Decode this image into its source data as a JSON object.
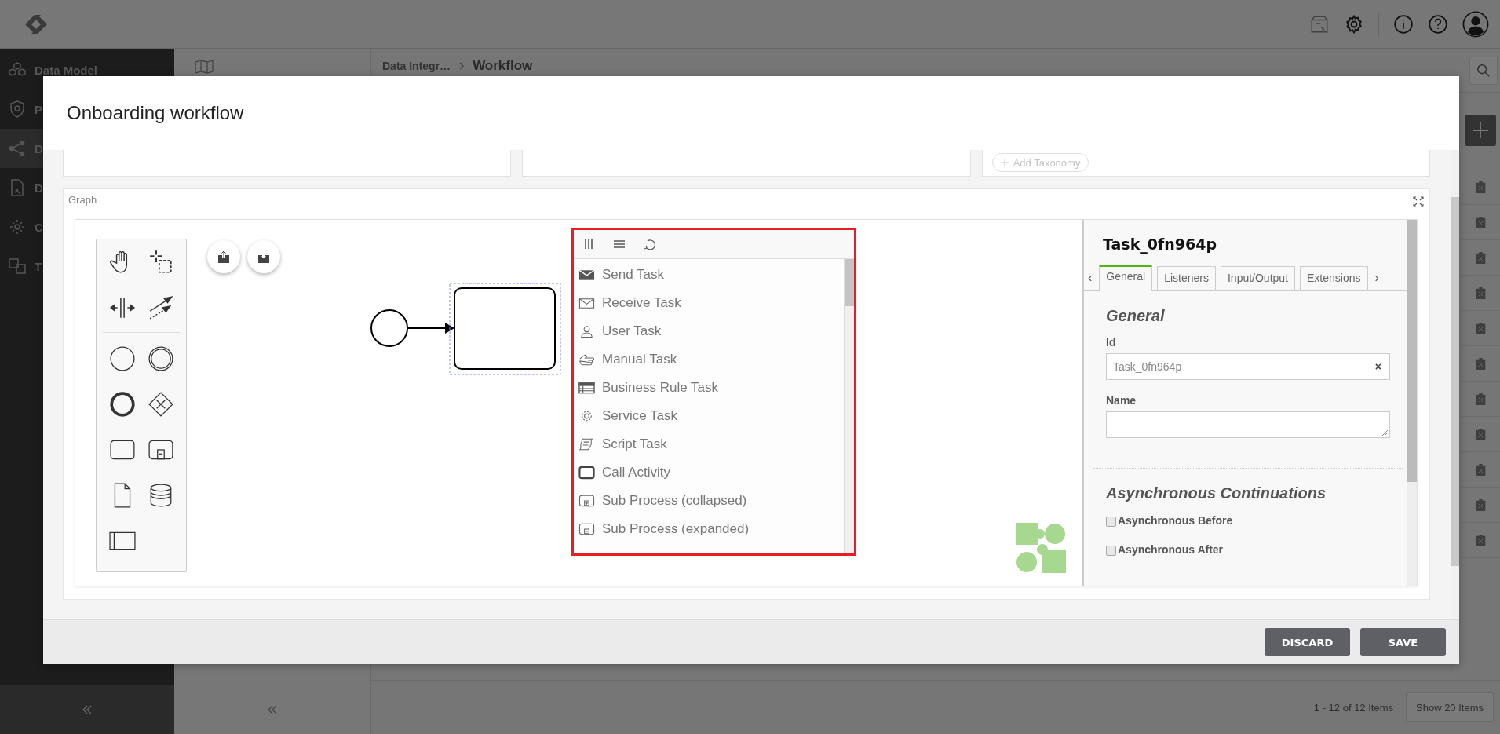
{
  "nav": {
    "items": [
      {
        "label": "Data Model",
        "selected": false
      },
      {
        "label": "P",
        "selected": false
      },
      {
        "label": "D",
        "selected": true
      },
      {
        "label": "D",
        "selected": false
      },
      {
        "label": "C",
        "selected": false
      },
      {
        "label": "T",
        "selected": false
      }
    ]
  },
  "breadcrumb": {
    "parent": "Data Integr…",
    "current": "Workflow"
  },
  "pager": {
    "summary": "1 - 12 of 12 Items",
    "page_size": "Show 20 Items"
  },
  "modal": {
    "title": "Onboarding workflow",
    "taxonomy_button": "Add Taxonomy",
    "graph": {
      "label": "Graph",
      "menu_items": [
        "Send Task",
        "Receive Task",
        "User Task",
        "Manual Task",
        "Business Rule Task",
        "Service Task",
        "Script Task",
        "Call Activity",
        "Sub Process (collapsed)",
        "Sub Process (expanded)"
      ],
      "properties": {
        "title": "Task_0fn964p",
        "prev": "‹",
        "next": "›",
        "tabs": [
          {
            "label": "General",
            "selected": true
          },
          {
            "label": "Listeners",
            "selected": false
          },
          {
            "label": "Input/Output",
            "selected": false
          },
          {
            "label": "Extensions",
            "selected": false
          }
        ],
        "section": "General",
        "fields": [
          {
            "label": "Id",
            "kind": "input",
            "value": "Task_0fn964p",
            "clear": "×"
          },
          {
            "label": "Name",
            "kind": "textarea"
          }
        ],
        "async_section": "Asynchronous Continuations",
        "checkboxes": [
          {
            "label": "Asynchronous Before",
            "checked": false
          },
          {
            "label": "Asynchronous After",
            "checked": false
          }
        ]
      }
    },
    "buttons": [
      "DISCARD",
      "SAVE"
    ]
  }
}
